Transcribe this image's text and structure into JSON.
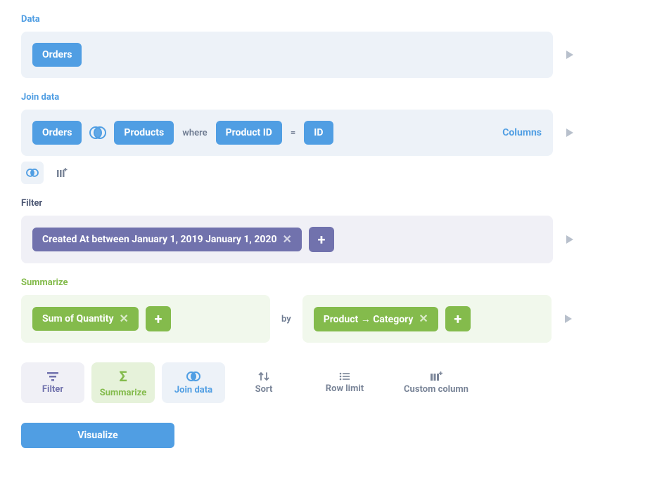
{
  "data": {
    "label": "Data",
    "pill": "Orders"
  },
  "join": {
    "label": "Join data",
    "left": "Orders",
    "right": "Products",
    "where": "where",
    "left_col": "Product ID",
    "eq": "=",
    "right_col": "ID",
    "columns": "Columns"
  },
  "filter": {
    "label": "Filter",
    "chip": "Created At between January 1, 2019 January 1, 2020"
  },
  "summarize": {
    "label": "Summarize",
    "agg": "Sum of Quantity",
    "by": "by",
    "group": "Product → Category"
  },
  "actions": {
    "filter": "Filter",
    "summarize": "Summarize",
    "join": "Join data",
    "sort": "Sort",
    "row_limit": "Row limit",
    "custom_column": "Custom column"
  },
  "visualize": "Visualize"
}
